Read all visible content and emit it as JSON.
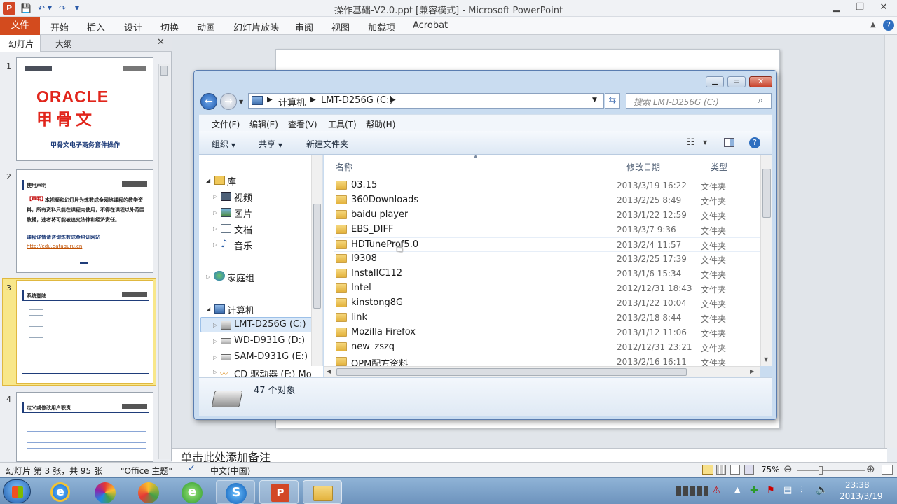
{
  "app": {
    "title": "操作基础-V2.0.ppt [兼容模式] - Microsoft PowerPoint"
  },
  "ribbon": {
    "file": "文件",
    "tabs": [
      "开始",
      "插入",
      "设计",
      "切换",
      "动画",
      "幻灯片放映",
      "审阅",
      "视图",
      "加载项",
      "Acrobat"
    ]
  },
  "left_panel": {
    "tabs": [
      "幻灯片",
      "大纲"
    ],
    "slides": [
      {
        "num": "1",
        "brand": "ORACLE",
        "brand_cn": "甲骨文",
        "caption": "甲骨文电子商务套件操作"
      },
      {
        "num": "2",
        "heading": "使用声明",
        "tag": "【声明】",
        "text": "本视频和幻灯片为炼数成金网络课程的教学资料，所有资料只能在课程内使用，不得在课程以外范围散播，违者将可能被追究法律和经济责任。",
        "link_label": "课程详情请咨询炼数成金培训网站",
        "url": "http://edu.dataguru.cn"
      },
      {
        "num": "3",
        "heading": "系统登陆"
      },
      {
        "num": "4",
        "heading": "定义或修改用户职责"
      }
    ]
  },
  "notes_placeholder": "单击此处添加备注",
  "status": {
    "slide_info": "幻灯片 第 3 张，共 95 张",
    "theme": "\"Office 主题\"",
    "language": "中文(中国)",
    "zoom": "75%"
  },
  "taskbar": {
    "time": "23:38",
    "date": "2013/3/19"
  },
  "explorer": {
    "breadcrumb": [
      "计算机",
      "LMT-D256G (C:)"
    ],
    "search_placeholder": "搜索 LMT-D256G (C:)",
    "menu": [
      "文件(F)",
      "编辑(E)",
      "查看(V)",
      "工具(T)",
      "帮助(H)"
    ],
    "commands": {
      "organize": "组织",
      "share": "共享",
      "new_folder": "新建文件夹"
    },
    "nav": {
      "libraries": "库",
      "lib_items": [
        "视频",
        "图片",
        "文档",
        "音乐"
      ],
      "homegroup": "家庭组",
      "computer": "计算机",
      "drives": [
        "LMT-D256G (C:)",
        "WD-D931G (D:)",
        "SAM-D931G (E:)",
        "CD 驱动器 (F:) Mob"
      ]
    },
    "columns": {
      "name": "名称",
      "date": "修改日期",
      "type": "类型"
    },
    "files": [
      {
        "name": "03.15",
        "date": "2013/3/19 16:22",
        "type": "文件夹"
      },
      {
        "name": "360Downloads",
        "date": "2013/2/25 8:49",
        "type": "文件夹"
      },
      {
        "name": "baidu player",
        "date": "2013/1/22 12:59",
        "type": "文件夹"
      },
      {
        "name": "EBS_DIFF",
        "date": "2013/3/7 9:36",
        "type": "文件夹"
      },
      {
        "name": "HDTuneProf5.0",
        "date": "2013/2/4 11:57",
        "type": "文件夹"
      },
      {
        "name": "I9308",
        "date": "2013/2/25 17:39",
        "type": "文件夹"
      },
      {
        "name": "InstallC112",
        "date": "2013/1/6 15:34",
        "type": "文件夹"
      },
      {
        "name": "Intel",
        "date": "2012/12/31 18:43",
        "type": "文件夹"
      },
      {
        "name": "kinstong8G",
        "date": "2013/1/22 10:04",
        "type": "文件夹"
      },
      {
        "name": "link",
        "date": "2013/2/18 8:44",
        "type": "文件夹"
      },
      {
        "name": "Mozilla Firefox",
        "date": "2013/1/12 11:06",
        "type": "文件夹"
      },
      {
        "name": "new_zszq",
        "date": "2012/12/31 23:21",
        "type": "文件夹"
      },
      {
        "name": "OPM配方资料",
        "date": "2013/2/16 16:11",
        "type": "文件夹"
      }
    ],
    "status_count": "47 个对象"
  }
}
